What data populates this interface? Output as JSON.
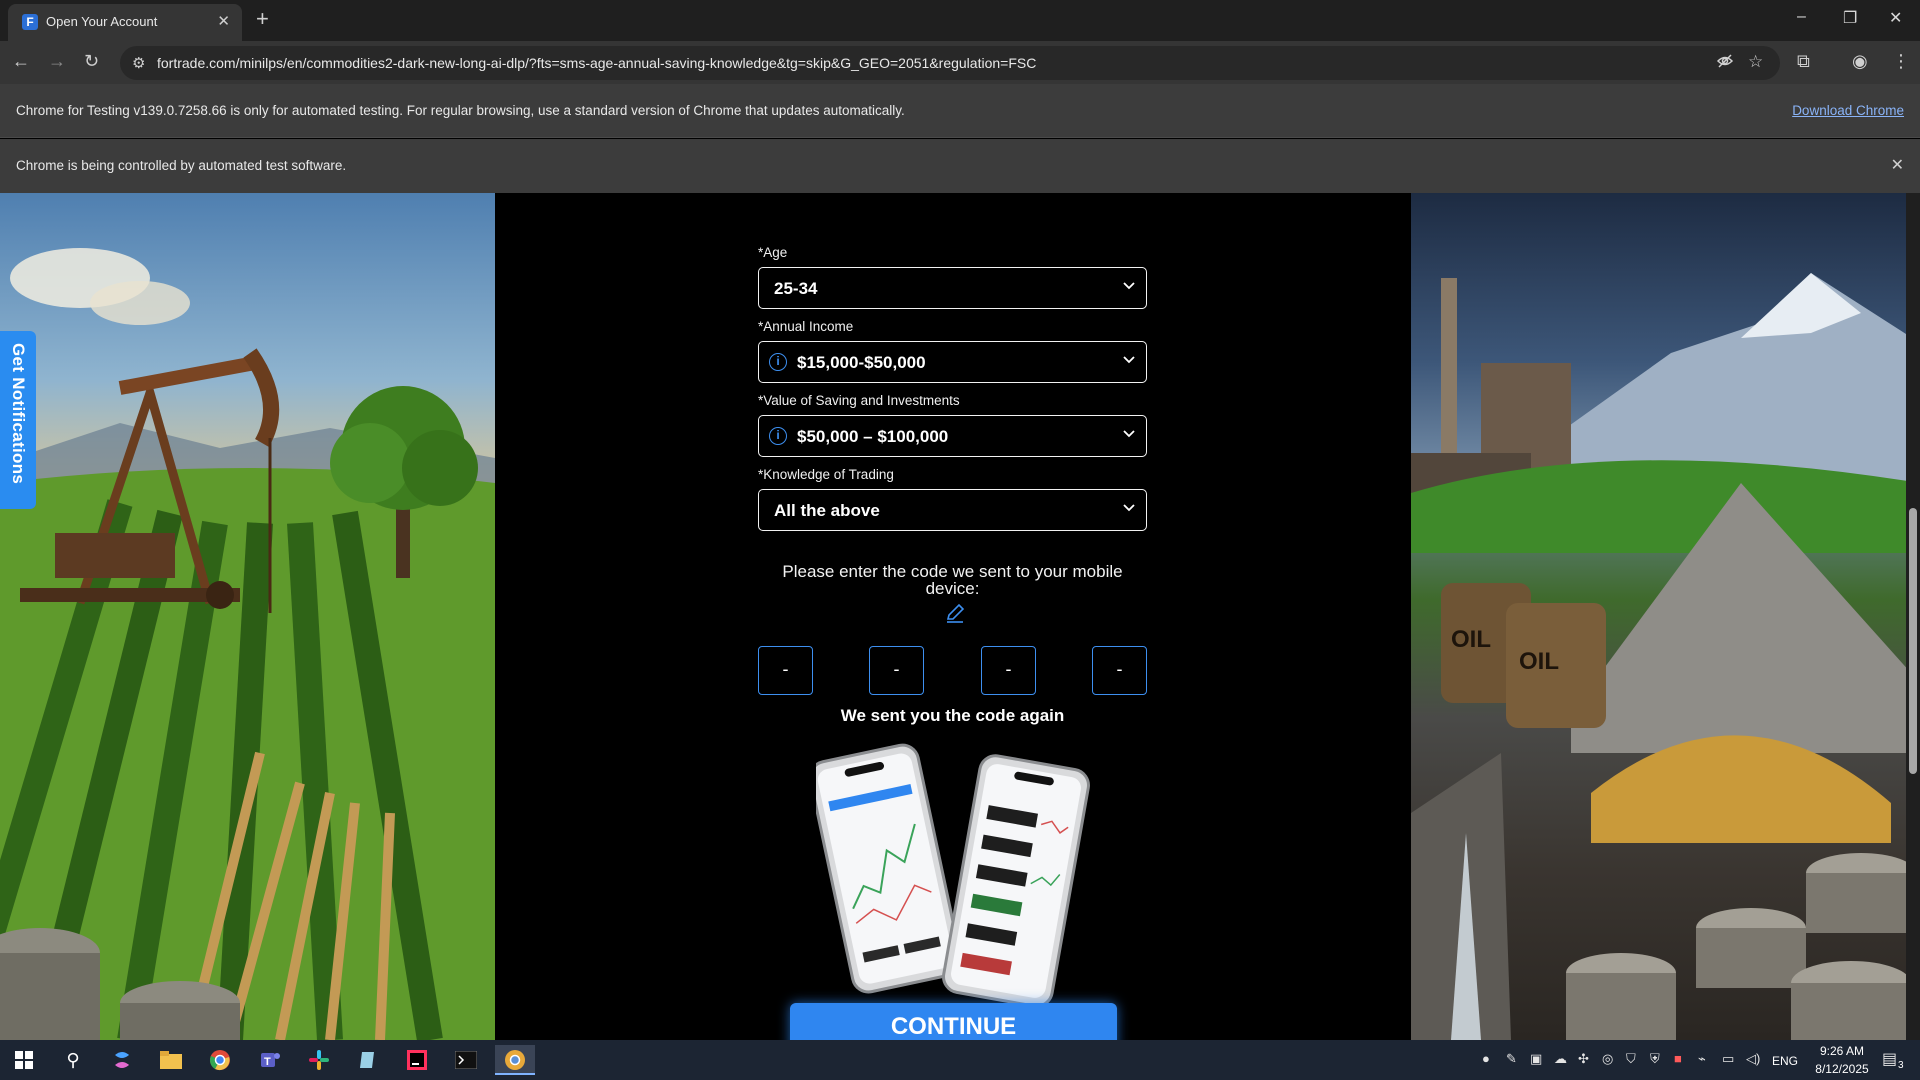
{
  "browser": {
    "tab_title": "Open Your Account",
    "tab_close": "✕",
    "new_tab": "+",
    "favicon_letter": "F",
    "url": "fortrade.com/minilps/en/commodities2-dark-new-long-ai-dlp/?fts=sms-age-annual-saving-knowledge&tg=skip&G_GEO=2051&regulation=FSC",
    "window_controls": {
      "minimize": "–",
      "restore": "❐",
      "close": "✕"
    },
    "nav": {
      "back": "←",
      "forward": "→",
      "reload": "↻"
    },
    "omnibox_icons": [
      "eye-slash-icon",
      "star-icon"
    ],
    "toolbar_icons": [
      "tab-search-icon",
      "profile-icon",
      "menu-icon"
    ]
  },
  "infobars": {
    "testing_text": "Chrome for Testing v139.0.7258.66 is only for automated testing. For regular browsing, use a standard version of Chrome that updates automatically.",
    "download_link": "Download Chrome",
    "automation_text": "Chrome is being controlled by automated test software.",
    "close": "✕"
  },
  "page": {
    "notifications_tab": "Get Notifications",
    "form": {
      "age": {
        "label": "*Age",
        "value": "25-34"
      },
      "income": {
        "label": "*Annual Income",
        "value": "$15,000-$50,000"
      },
      "savings": {
        "label": "*Value of Saving and Investments",
        "value": "$50,000 – $100,000"
      },
      "knowledge": {
        "label": "*Knowledge of Trading",
        "value": "All the above"
      },
      "info_symbol": "i",
      "chevron": "⌄",
      "code_prompt": "Please enter the code we sent to your mobile device:",
      "code_digits": [
        "-",
        "-",
        "-",
        "-"
      ],
      "resent_text": "We sent you the code again",
      "continue_label": "CONTINUE"
    },
    "left_image_labels": [],
    "right_image_labels": [
      "OIL",
      "OIL"
    ],
    "accent_color": "#2f86f0"
  },
  "taskbar": {
    "apps": [
      "start-icon",
      "search-icon",
      "copilot-icon",
      "file-explorer-icon",
      "chrome-icon",
      "teams-icon",
      "slack-icon",
      "notepad-icon",
      "intellij-icon",
      "terminal-icon",
      "chrome-testing-icon"
    ],
    "language": "ENG",
    "time": "9:26 AM",
    "date": "8/12/2025",
    "notification_count": "3"
  }
}
